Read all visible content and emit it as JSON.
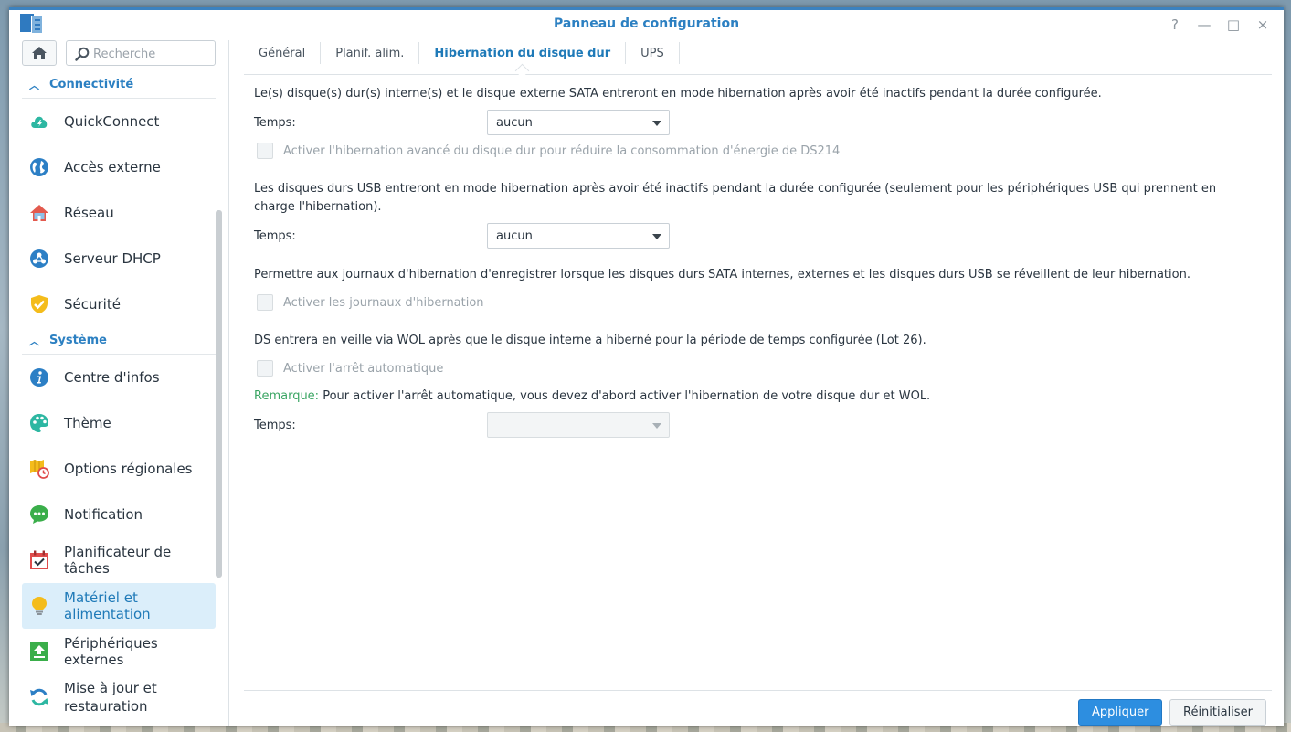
{
  "window": {
    "title": "Panneau de configuration",
    "controls": [
      "?",
      "—",
      "□",
      "×"
    ]
  },
  "search": {
    "placeholder": "Recherche"
  },
  "sidebar": {
    "sections": [
      {
        "label": "Connectivité",
        "items": [
          {
            "label": "QuickConnect",
            "icon": "quickconnect-icon"
          },
          {
            "label": "Accès externe",
            "icon": "globe-icon"
          },
          {
            "label": "Réseau",
            "icon": "home-network-icon"
          },
          {
            "label": "Serveur DHCP",
            "icon": "dhcp-icon"
          },
          {
            "label": "Sécurité",
            "icon": "shield-icon"
          }
        ]
      },
      {
        "label": "Système",
        "items": [
          {
            "label": "Centre d'infos",
            "icon": "info-icon"
          },
          {
            "label": "Thème",
            "icon": "palette-icon"
          },
          {
            "label": "Options régionales",
            "icon": "regional-icon"
          },
          {
            "label": "Notification",
            "icon": "chat-bubble-icon"
          },
          {
            "label": "Planificateur de tâches",
            "icon": "calendar-check-icon"
          },
          {
            "label": "Matériel et alimentation",
            "icon": "lightbulb-icon",
            "active": true
          },
          {
            "label": "Périphériques externes",
            "icon": "upload-icon"
          },
          {
            "label": "Mise à jour et restauration",
            "line1": "Mise à jour et",
            "line2": "restauration",
            "icon": "refresh-icon"
          }
        ]
      }
    ]
  },
  "tabs": [
    "Général",
    "Planif. alim.",
    "Hibernation du disque dur",
    "UPS"
  ],
  "active_tab": "Hibernation du disque dur",
  "content": {
    "p1": "Le(s) disque(s) dur(s) interne(s) et le disque externe SATA entreront en mode hibernation après avoir été inactifs pendant la durée configurée.",
    "time_label": "Temps:",
    "select1_value": "aucun",
    "chk1_label": "Activer l'hibernation avancé du disque dur pour réduire la consommation d'énergie de DS214",
    "p2": "Les disques durs USB entreront en mode hibernation après avoir été inactifs pendant la durée configurée (seulement pour les périphériques USB qui prennent en charge l'hibernation).",
    "select2_value": "aucun",
    "p3": "Permettre aux journaux d'hibernation d'enregistrer lorsque les disques durs SATA internes, externes et les disques durs USB se réveillent de leur hibernation.",
    "chk2_label": "Activer les journaux d'hibernation",
    "p4": "DS entrera en veille via WOL après que le disque interne a hiberné pour la période de temps configurée (Lot 26).",
    "chk3_label": "Activer l'arrêt automatique",
    "remark_key": "Remarque:",
    "remark_text": " Pour activer l'arrêt automatique, vous devez d'abord activer l'hibernation de votre disque dur et WOL.",
    "select3_value": ""
  },
  "footer": {
    "apply": "Appliquer",
    "reset": "Réinitialiser"
  },
  "colors": {
    "accent": "#2c80c2",
    "remark": "#3aa563",
    "active_bg": "#dbeefa",
    "apply_bg": "#2d8ee0"
  }
}
